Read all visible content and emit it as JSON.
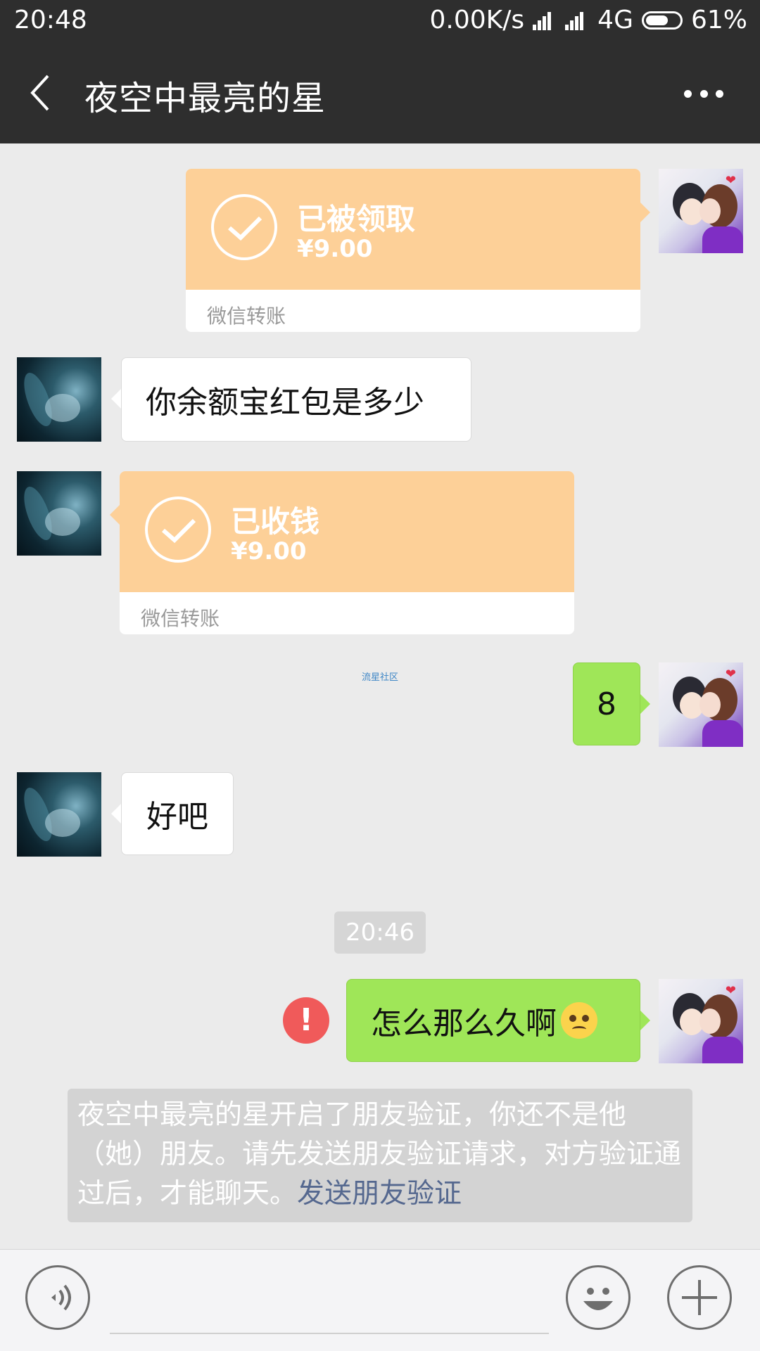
{
  "status_bar": {
    "time": "20:48",
    "network_speed": "0.00K/s",
    "network_type": "4G",
    "battery": "61%"
  },
  "header": {
    "title": "夜空中最亮的星",
    "back_icon": "chevron-left-icon",
    "more_icon": "more-horizontal-icon"
  },
  "messages": [
    {
      "type": "transfer",
      "sender": "me",
      "status": "已被领取",
      "amount": "¥9.00",
      "label": "微信转账"
    },
    {
      "type": "text",
      "sender": "other",
      "text": "你余额宝红包是多少"
    },
    {
      "type": "transfer",
      "sender": "other",
      "status": "已收钱",
      "amount": "¥9.00",
      "label": "微信转账"
    },
    {
      "type": "text",
      "sender": "me",
      "text": "8"
    },
    {
      "type": "text",
      "sender": "other",
      "text": "好吧"
    },
    {
      "type": "time",
      "text": "20:46"
    },
    {
      "type": "text",
      "sender": "me",
      "text": "怎么那么久啊",
      "failed": true,
      "emoji": "woozy-face-icon"
    }
  ],
  "watermark": "流星社区",
  "notice": {
    "text": "夜空中最亮的星开启了朋友验证，你还不是他（她）朋友。请先发送朋友验证请求，对方验证通过后，才能聊天。",
    "link": "发送朋友验证"
  },
  "input_bar": {
    "voice_icon": "voice-icon",
    "emoji_icon": "smiley-icon",
    "plus_icon": "plus-icon"
  },
  "colors": {
    "header_bg": "#2e2e2e",
    "transfer_bg": "#fdd098",
    "my_bubble_bg": "#9fe658",
    "error_red": "#f05a5a",
    "link_blue": "#55688f"
  }
}
